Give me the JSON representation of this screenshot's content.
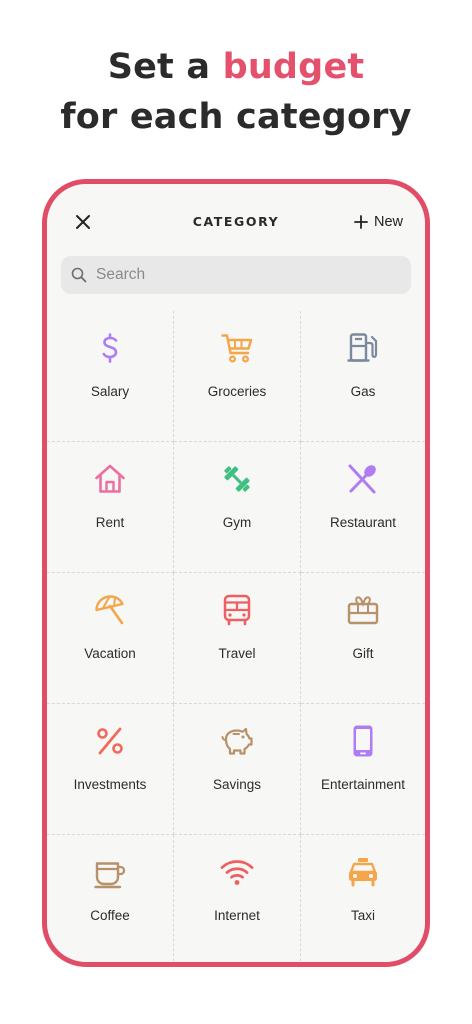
{
  "headline": {
    "line1_prefix": "Set a ",
    "line1_accent": "budget",
    "line2": "for each category"
  },
  "screen": {
    "title": "CATEGORY",
    "close_icon": "close-icon",
    "new_label": "New",
    "search_placeholder": "Search"
  },
  "colors": {
    "accent": "#e5516c",
    "frame": "#e14d66",
    "purple": "#b07cf3",
    "orange": "#f4a64a",
    "slate": "#7a8a9c",
    "pink": "#ec6fa1",
    "green": "#3fbf80",
    "red": "#ef5f5f",
    "brown": "#b8916a",
    "coral": "#f26a5a"
  },
  "categories": [
    {
      "label": "Salary",
      "icon": "dollar-icon"
    },
    {
      "label": "Groceries",
      "icon": "cart-icon"
    },
    {
      "label": "Gas",
      "icon": "gas-pump-icon"
    },
    {
      "label": "Rent",
      "icon": "house-icon"
    },
    {
      "label": "Gym",
      "icon": "dumbbell-icon"
    },
    {
      "label": "Restaurant",
      "icon": "utensils-icon"
    },
    {
      "label": "Vacation",
      "icon": "umbrella-icon"
    },
    {
      "label": "Travel",
      "icon": "bus-icon"
    },
    {
      "label": "Gift",
      "icon": "gift-icon"
    },
    {
      "label": "Investments",
      "icon": "percent-icon"
    },
    {
      "label": "Savings",
      "icon": "piggy-bank-icon"
    },
    {
      "label": "Entertainment",
      "icon": "phone-icon"
    },
    {
      "label": "Coffee",
      "icon": "coffee-icon"
    },
    {
      "label": "Internet",
      "icon": "wifi-icon"
    },
    {
      "label": "Taxi",
      "icon": "taxi-icon"
    }
  ]
}
